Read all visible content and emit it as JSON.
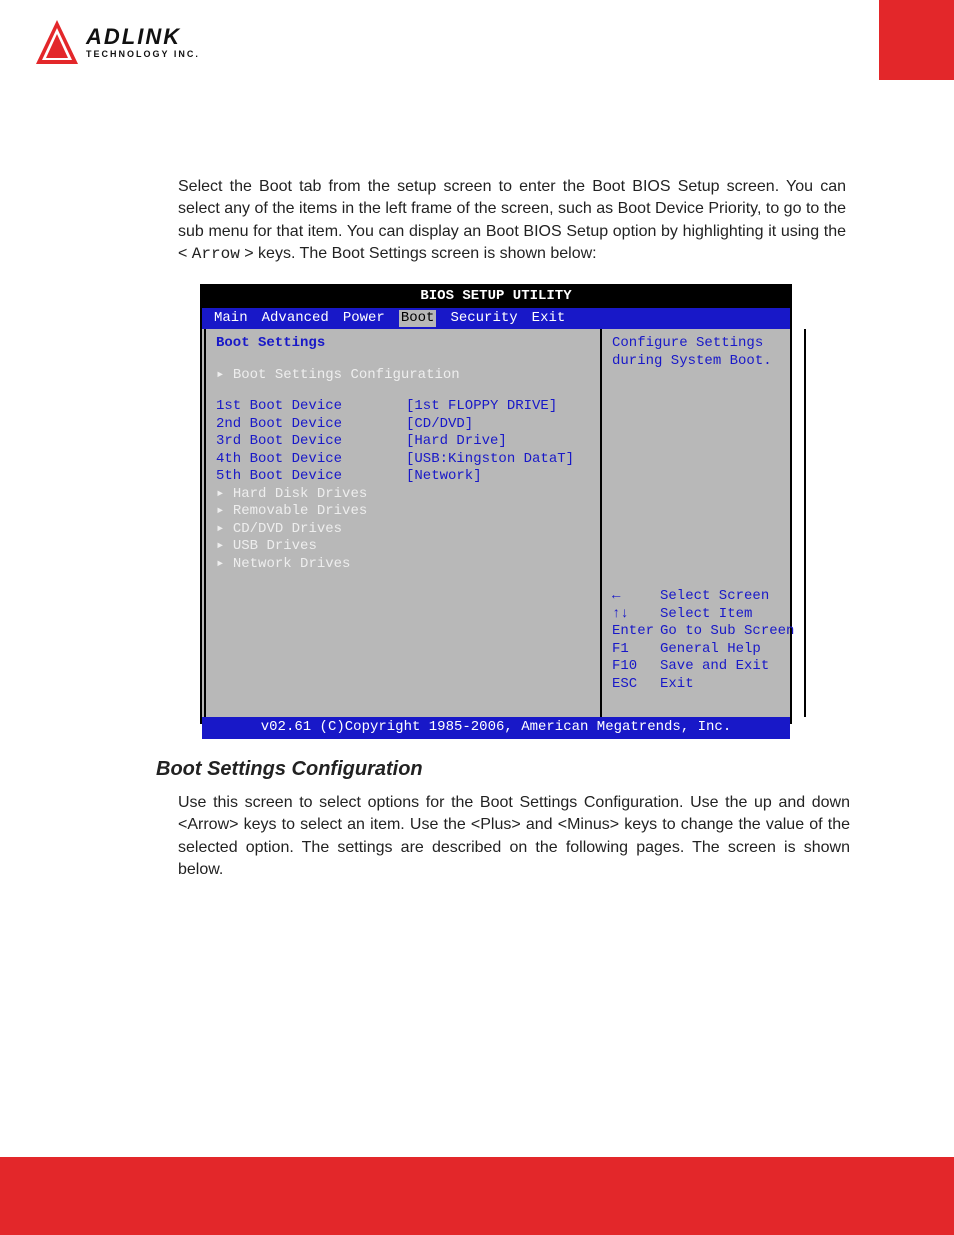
{
  "logo": {
    "main": "ADLINK",
    "sub": "TECHNOLOGY INC."
  },
  "intro": {
    "p1a": "Select the Boot tab from the setup screen to enter the Boot BIOS Setup screen. You can select any of the items in the left frame of the screen, such as Boot Device Priority, to go to the sub menu for that item. You can display an Boot BIOS Setup option by highlighting it using the < ",
    "arrow": "Arrow",
    "p1b": " > keys. The Boot Settings screen is shown below:"
  },
  "bios": {
    "title": "BIOS SETUP UTILITY",
    "tabs": {
      "main": "Main",
      "advanced": "Advanced",
      "power": "Power",
      "boot": "Boot",
      "security": "Security",
      "exit": "Exit"
    },
    "left": {
      "heading": "Boot Settings",
      "config": "Boot Settings Configuration",
      "rows": [
        {
          "label": "1st Boot Device",
          "value": "[1st FLOPPY DRIVE]"
        },
        {
          "label": "2nd Boot Device",
          "value": "[CD/DVD]"
        },
        {
          "label": "3rd Boot Device",
          "value": "[Hard Drive]"
        },
        {
          "label": "4th Boot Device",
          "value": "[USB:Kingston DataT]"
        },
        {
          "label": "5th Boot Device",
          "value": "[Network]"
        }
      ],
      "submenus": [
        "Hard Disk Drives",
        "Removable Drives",
        "CD/DVD Drives",
        "USB Drives",
        "Network Drives"
      ]
    },
    "right": {
      "desc1": "Configure Settings",
      "desc2": "during System Boot.",
      "help": [
        {
          "key": "←",
          "text": "Select Screen"
        },
        {
          "key": "↑↓",
          "text": "Select Item"
        },
        {
          "key": "Enter",
          "text": "Go to Sub Screen"
        },
        {
          "key": "F1",
          "text": "General Help"
        },
        {
          "key": "F10",
          "text": "Save and Exit"
        },
        {
          "key": "ESC",
          "text": "Exit"
        }
      ]
    },
    "footer": "v02.61 (C)Copyright 1985-2006, American Megatrends, Inc."
  },
  "subsection": {
    "heading": "Boot Settings Configuration",
    "body": "Use this screen to select options for the Boot Settings Configuration. Use the up and down <Arrow> keys to select an item. Use the <Plus> and <Minus> keys to change the value of the selected option. The settings are described on the following pages. The screen is shown below."
  }
}
